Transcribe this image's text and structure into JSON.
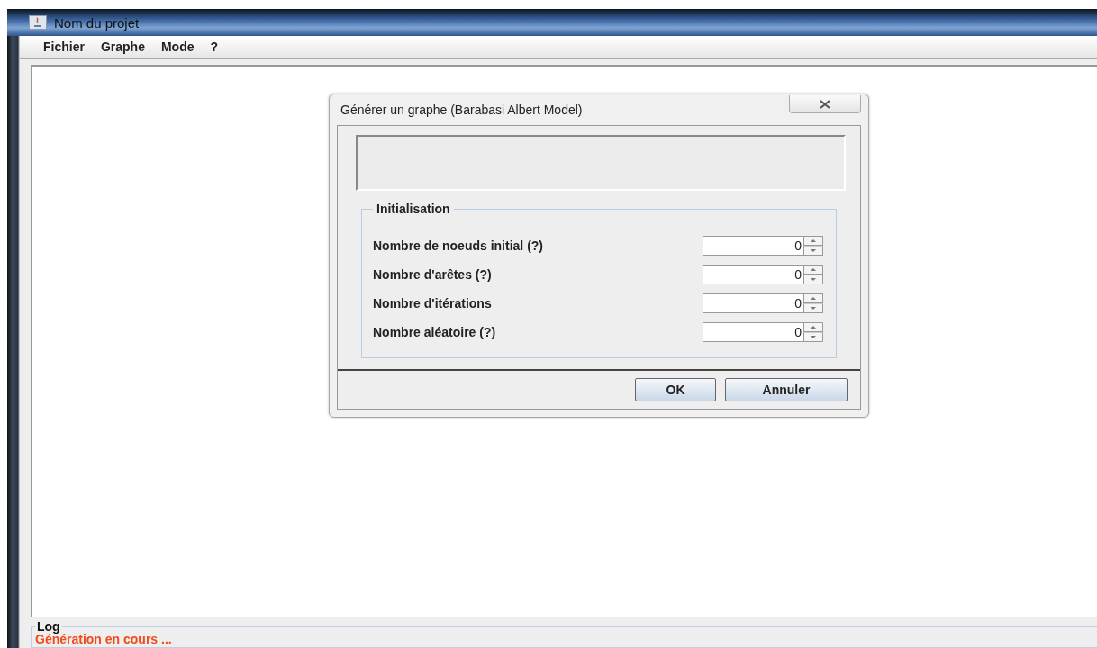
{
  "window": {
    "title": "Nom du projet"
  },
  "menu": [
    "Fichier",
    "Graphe",
    "Mode",
    "?"
  ],
  "dialog": {
    "title": "Générer un graphe (Barabasi Albert Model)",
    "group": {
      "title": "Initialisation",
      "fields": [
        {
          "label": "Nombre de noeuds initial (?)",
          "value": "0"
        },
        {
          "label": "Nombre d'arêtes (?)",
          "value": "0"
        },
        {
          "label": "Nombre d'itérations",
          "value": "0"
        },
        {
          "label": "Nombre aléatoire (?)",
          "value": "0"
        }
      ]
    },
    "buttons": [
      "OK",
      "Annuler"
    ]
  },
  "log": {
    "title": "Log",
    "message": "Génération en cours ..."
  }
}
